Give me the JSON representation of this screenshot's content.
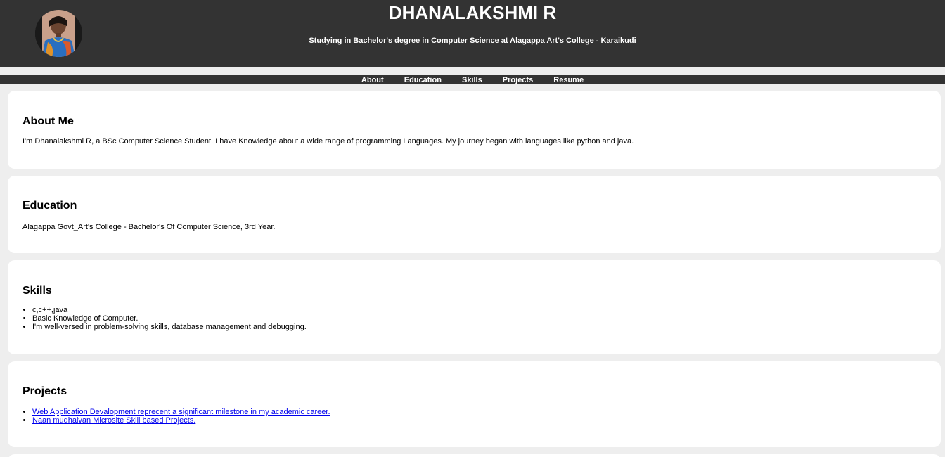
{
  "header": {
    "name": "DHANALAKSHMI R",
    "subtitle": "Studying in Bachelor's degree in Computer Science at Alagappa Art's College - Karaikudi"
  },
  "nav": {
    "items": [
      "About",
      "Education",
      "Skills",
      "Projects",
      "Resume"
    ]
  },
  "about": {
    "title": "About Me",
    "text": "I'm Dhanalakshmi R, a BSc Computer Science Student. I have Knowledge about a wide range of programming Languages. My journey began with languages like python and java."
  },
  "education": {
    "title": "Education",
    "text": "Alagappa Govt_Art's College - Bachelor's Of Computer Science, 3rd Year."
  },
  "skills": {
    "title": "Skills",
    "items": [
      "c,c++,java",
      "Basic Knowledge of Computer.",
      "I'm well-versed in problem-solving skills, database management and debugging."
    ]
  },
  "projects": {
    "title": "Projects",
    "items": [
      "Web Application Devalopment reprecent a significant milestone in my academic career.",
      "Naan mudhalvan Microsite Skill based Projects."
    ]
  },
  "colors": {
    "header_bg": "#333333",
    "page_bg": "#eeeeee",
    "card_bg": "#ffffff",
    "link": "#0000ee"
  }
}
